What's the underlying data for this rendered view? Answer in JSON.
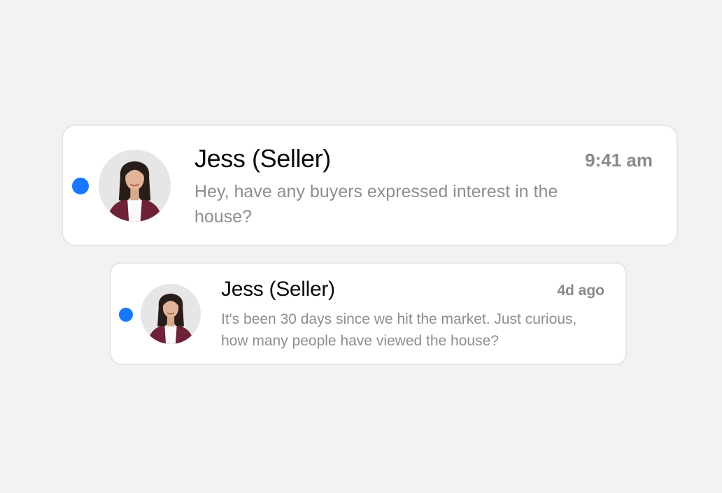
{
  "colors": {
    "background": "#f2f2f2",
    "card": "#ffffff",
    "unread_dot": "#1677ff",
    "sender_text": "#0b0b0b",
    "muted_text": "#8e8e8e"
  },
  "messages": [
    {
      "sender": "Jess (Seller)",
      "time": "9:41 am",
      "preview": "Hey, have any buyers expressed interest in the house?",
      "unread": true,
      "avatar_icon": "person-photo-icon"
    },
    {
      "sender": "Jess (Seller)",
      "time": "4d ago",
      "preview": "It's been 30 days since we hit the market. Just curious, how many people have viewed the house?",
      "unread": true,
      "avatar_icon": "person-photo-icon"
    }
  ]
}
